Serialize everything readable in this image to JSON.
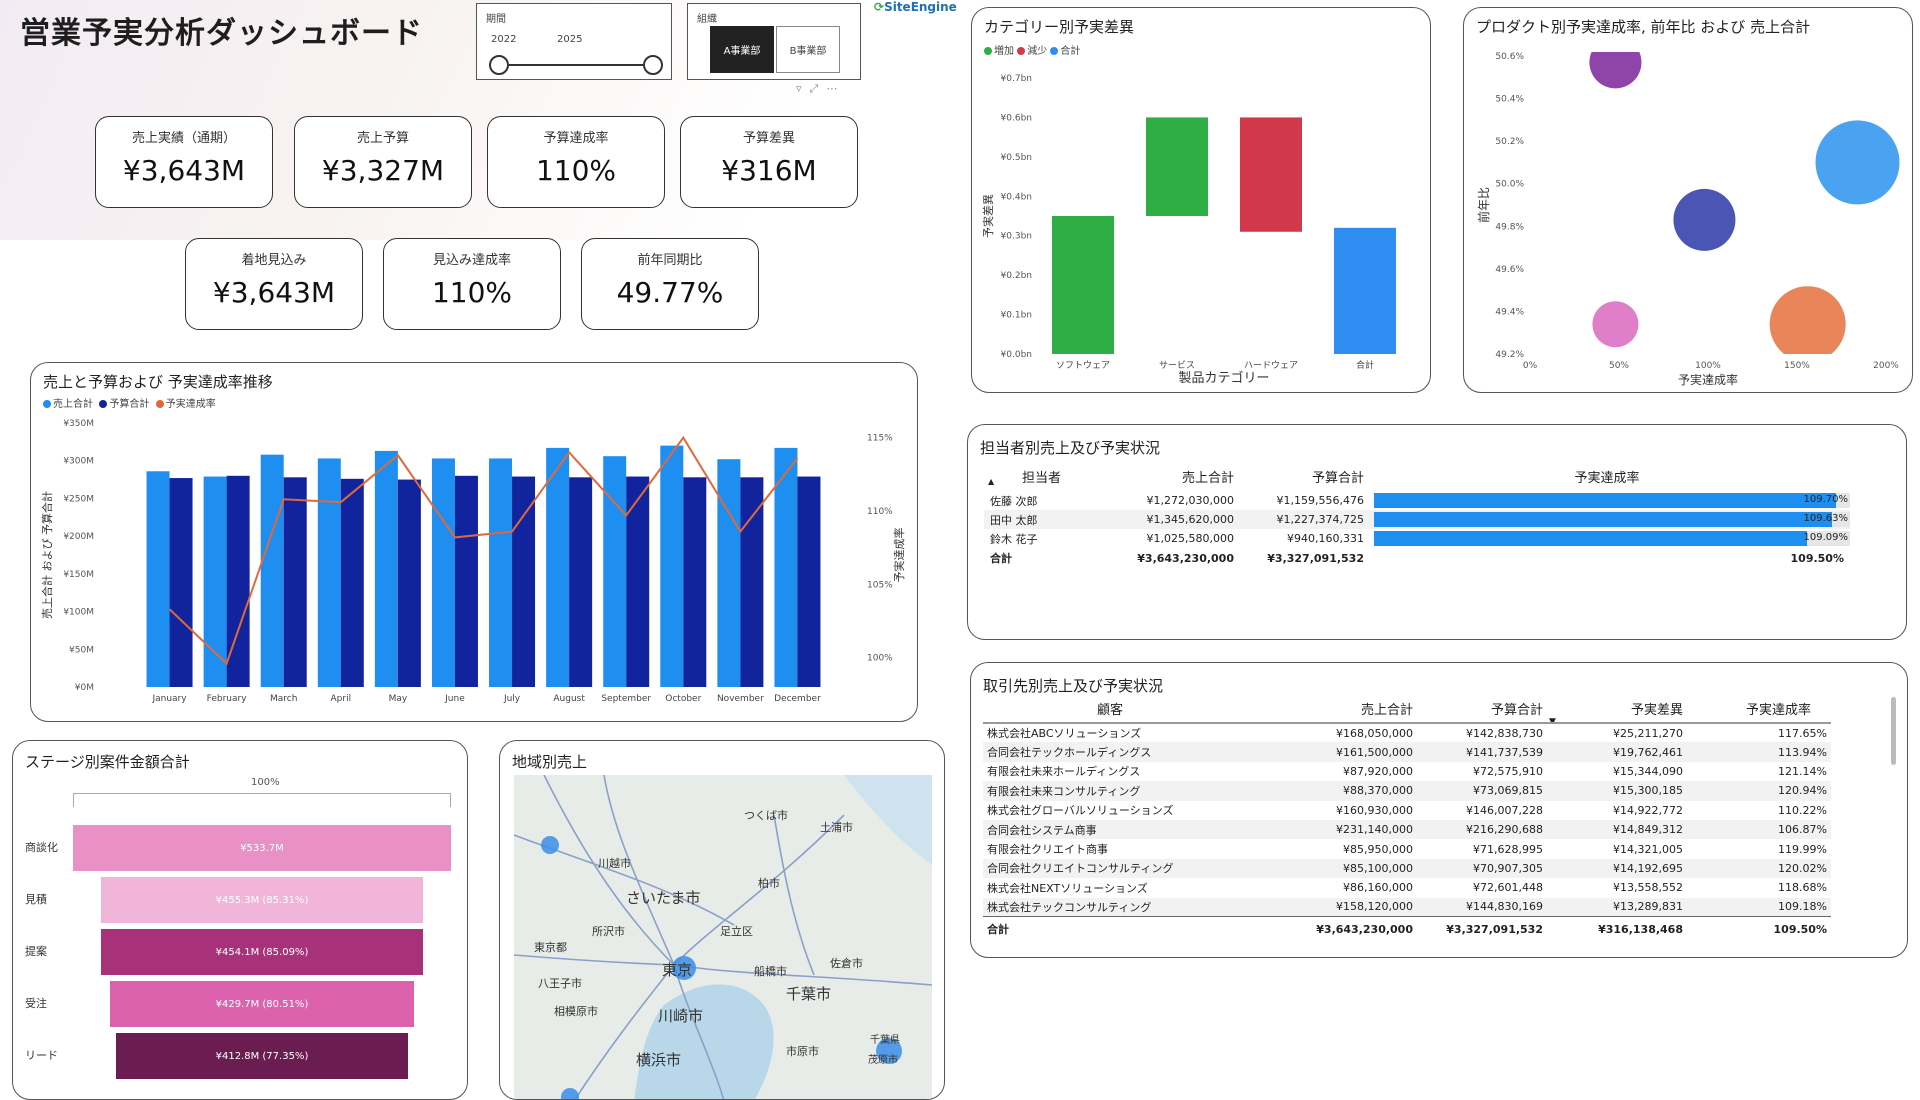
{
  "header": {
    "title": "営業予実分析ダッシュボード",
    "period_slicer": {
      "label": "期間",
      "from": "2022",
      "to": "2025"
    },
    "org_slicer": {
      "label": "組織",
      "options": [
        "A事業部",
        "B事業部"
      ],
      "selected": "A事業部"
    },
    "logo": "SiteEngine"
  },
  "kpis_row1": [
    {
      "label": "売上実績（通期）",
      "value": "¥3,643M"
    },
    {
      "label": "売上予算",
      "value": "¥3,327M"
    },
    {
      "label": "予算達成率",
      "value": "110%"
    },
    {
      "label": "予算差異",
      "value": "¥316M"
    }
  ],
  "kpis_row2": [
    {
      "label": "着地見込み",
      "value": "¥3,643M"
    },
    {
      "label": "見込み達成率",
      "value": "110%"
    },
    {
      "label": "前年同期比",
      "value": "49.77%"
    }
  ],
  "monthly": {
    "title": "売上と予算および 予実達成率推移",
    "legend": [
      "売上合計",
      "予算合計",
      "予実達成率"
    ],
    "ylabel": "売上合計 および 予算合計",
    "y2label": "予実達成率",
    "ytick_labels": [
      "¥0M",
      "¥50M",
      "¥100M",
      "¥150M",
      "¥200M",
      "¥250M",
      "¥300M",
      "¥350M"
    ],
    "y2tick_labels": [
      "100%",
      "105%",
      "110%",
      "115%"
    ],
    "colors": {
      "sales": "#1f8ef1",
      "budget": "#12239e",
      "rate": "#e0693a"
    }
  },
  "category": {
    "title": "カテゴリー別予実差異",
    "legend": [
      "増加",
      "減少",
      "合計"
    ],
    "ylabel": "予実差異",
    "xlabel": "製品カテゴリー",
    "ytick_labels": [
      "¥0.0bn",
      "¥0.1bn",
      "¥0.2bn",
      "¥0.3bn",
      "¥0.4bn",
      "¥0.5bn",
      "¥0.6bn",
      "¥0.7bn"
    ],
    "colors": {
      "increase": "#2fae45",
      "decrease": "#d1394a",
      "total": "#2f8ef1"
    }
  },
  "product": {
    "title": "プロダクト別予実達成率, 前年比 および 売上合計",
    "ylabel": "前年比",
    "xlabel": "予実達成率",
    "xtick_labels": [
      "0%",
      "50%",
      "100%",
      "150%",
      "200%"
    ],
    "ytick_labels": [
      "49.2%",
      "49.4%",
      "49.6%",
      "49.8%",
      "50.0%",
      "50.2%",
      "50.4%",
      "50.6%"
    ]
  },
  "reps": {
    "title": "担当者別売上及び予実状況",
    "columns": [
      "担当者",
      "売上合計",
      "予算合計",
      "予実達成率"
    ],
    "rows": [
      {
        "name": "佐藤 次郎",
        "sales": "¥1,272,030,000",
        "budget": "¥1,159,556,476",
        "rate": "109.70%",
        "rate_value": 109.7
      },
      {
        "name": "田中 太郎",
        "sales": "¥1,345,620,000",
        "budget": "¥1,227,374,725",
        "rate": "109.63%",
        "rate_value": 109.63
      },
      {
        "name": "鈴木 花子",
        "sales": "¥1,025,580,000",
        "budget": "¥940,160,331",
        "rate": "109.09%",
        "rate_value": 109.09
      }
    ],
    "total": {
      "name": "合計",
      "sales": "¥3,643,230,000",
      "budget": "¥3,327,091,532",
      "rate": "109.50%"
    }
  },
  "clients": {
    "title": "取引先別売上及び予実状況",
    "columns": [
      "顧客",
      "売上合計",
      "予算合計",
      "予実差異",
      "予実達成率"
    ],
    "rows": [
      [
        "株式会社ABCソリューションズ",
        "¥168,050,000",
        "¥142,838,730",
        "¥25,211,270",
        "117.65%"
      ],
      [
        "合同会社テックホールディングス",
        "¥161,500,000",
        "¥141,737,539",
        "¥19,762,461",
        "113.94%"
      ],
      [
        "有限会社未来ホールディングス",
        "¥87,920,000",
        "¥72,575,910",
        "¥15,344,090",
        "121.14%"
      ],
      [
        "有限会社未来コンサルティング",
        "¥88,370,000",
        "¥73,069,815",
        "¥15,300,185",
        "120.94%"
      ],
      [
        "株式会社グローバルソリューションズ",
        "¥160,930,000",
        "¥146,007,228",
        "¥14,922,772",
        "110.22%"
      ],
      [
        "合同会社システム商事",
        "¥231,140,000",
        "¥216,290,688",
        "¥14,849,312",
        "106.87%"
      ],
      [
        "有限会社クリエイト商事",
        "¥85,950,000",
        "¥71,628,995",
        "¥14,321,005",
        "119.99%"
      ],
      [
        "合同会社クリエイトコンサルティング",
        "¥85,100,000",
        "¥70,907,305",
        "¥14,192,695",
        "120.02%"
      ],
      [
        "株式会社NEXTソリューションズ",
        "¥86,160,000",
        "¥72,601,448",
        "¥13,558,552",
        "118.68%"
      ],
      [
        "株式会社テックコンサルティング",
        "¥158,120,000",
        "¥144,830,169",
        "¥13,289,831",
        "109.18%"
      ]
    ],
    "total": [
      "合計",
      "¥3,643,230,000",
      "¥3,327,091,532",
      "¥316,138,468",
      "109.50%"
    ]
  },
  "funnel": {
    "title": "ステージ別案件金額合計",
    "top_label": "100%",
    "stages": [
      {
        "stage": "商談化",
        "label": "¥533.7M",
        "value": 533.7,
        "pct": 100,
        "color": "#e991c7"
      },
      {
        "stage": "見積",
        "label": "¥455.3M (85.31%)",
        "value": 455.3,
        "pct": 85.31,
        "color": "#f0b5d8"
      },
      {
        "stage": "提案",
        "label": "¥454.1M (85.09%)",
        "value": 454.1,
        "pct": 85.09,
        "color": "#a8327a"
      },
      {
        "stage": "受注",
        "label": "¥429.7M (80.51%)",
        "value": 429.7,
        "pct": 80.51,
        "color": "#dd62ad"
      },
      {
        "stage": "リード",
        "label": "¥412.8M (77.35%)",
        "value": 412.8,
        "pct": 77.35,
        "color": "#6b1c50"
      }
    ]
  },
  "map": {
    "title": "地域別売上",
    "places": [
      "つくば市",
      "土浦市",
      "川越市",
      "さいたま市",
      "柏市",
      "所沢市",
      "足立区",
      "東京都",
      "東京",
      "船橋市",
      "佐倉市",
      "八王子市",
      "千葉市",
      "相模原市",
      "川崎市",
      "市原市",
      "横浜市",
      "茂原市",
      "千葉県"
    ]
  },
  "chart_data": [
    {
      "type": "bar",
      "title": "売上と予算および 予実達成率推移",
      "categories": [
        "January",
        "February",
        "March",
        "April",
        "May",
        "June",
        "July",
        "August",
        "September",
        "October",
        "November",
        "December"
      ],
      "series": [
        {
          "name": "売上合計",
          "values": [
            286,
            279,
            308,
            303,
            313,
            303,
            303,
            317,
            306,
            320,
            302,
            317
          ]
        },
        {
          "name": "予算合計",
          "values": [
            277,
            280,
            278,
            276,
            275,
            280,
            279,
            278,
            279,
            278,
            278,
            279
          ]
        },
        {
          "name": "予実達成率",
          "axis": "right",
          "values": [
            103.3,
            99.6,
            110.8,
            110.6,
            113.8,
            108.2,
            108.6,
            114.0,
            109.7,
            115.0,
            108.6,
            113.6
          ]
        }
      ],
      "ylim": [
        0,
        350
      ],
      "y2lim": [
        98,
        116
      ]
    },
    {
      "type": "bar",
      "subtype": "waterfall",
      "title": "カテゴリー別予実差異",
      "categories": [
        "ソフトウェア",
        "サービス",
        "ハードウェア",
        "合計"
      ],
      "values": [
        0.35,
        0.25,
        -0.29,
        0.32
      ],
      "kinds": [
        "増加",
        "増加",
        "減少",
        "合計"
      ],
      "ylim": [
        0,
        0.7
      ]
    },
    {
      "type": "scatter",
      "subtype": "bubble",
      "title": "プロダクト別予実達成率, 前年比 および 売上合計",
      "points": [
        {
          "x": 48,
          "y": 50.57,
          "r": 26,
          "color": "#8e44a8"
        },
        {
          "x": 184,
          "y": 50.1,
          "r": 42,
          "color": "#4aa3f0"
        },
        {
          "x": 98,
          "y": 49.83,
          "r": 31,
          "color": "#4a55b4"
        },
        {
          "x": 48,
          "y": 49.34,
          "r": 23,
          "color": "#e07ec8"
        },
        {
          "x": 156,
          "y": 49.34,
          "r": 38,
          "color": "#e8865a"
        }
      ],
      "xlim": [
        0,
        200
      ],
      "ylim": [
        49.2,
        50.6
      ]
    }
  ]
}
